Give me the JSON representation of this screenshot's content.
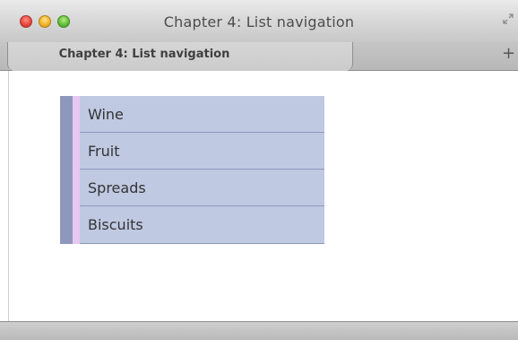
{
  "window": {
    "title": "Chapter 4: List navigation",
    "controls": {
      "close": "close-button",
      "minimize": "minimize-button",
      "zoom": "zoom-button",
      "fullscreen_icon": "fullscreen-arrows-icon"
    }
  },
  "tabs": [
    {
      "label": "Chapter 4: List navigation",
      "active": true
    }
  ],
  "new_tab_label": "+",
  "nav": {
    "items": [
      {
        "label": "Wine"
      },
      {
        "label": "Fruit"
      },
      {
        "label": "Spreads"
      },
      {
        "label": "Biscuits"
      }
    ],
    "colors": {
      "item_background": "#c0c9e2",
      "separator": "#8e98bd",
      "accent_dark": "#8e98bd",
      "accent_light": "#e6c8f2"
    }
  }
}
